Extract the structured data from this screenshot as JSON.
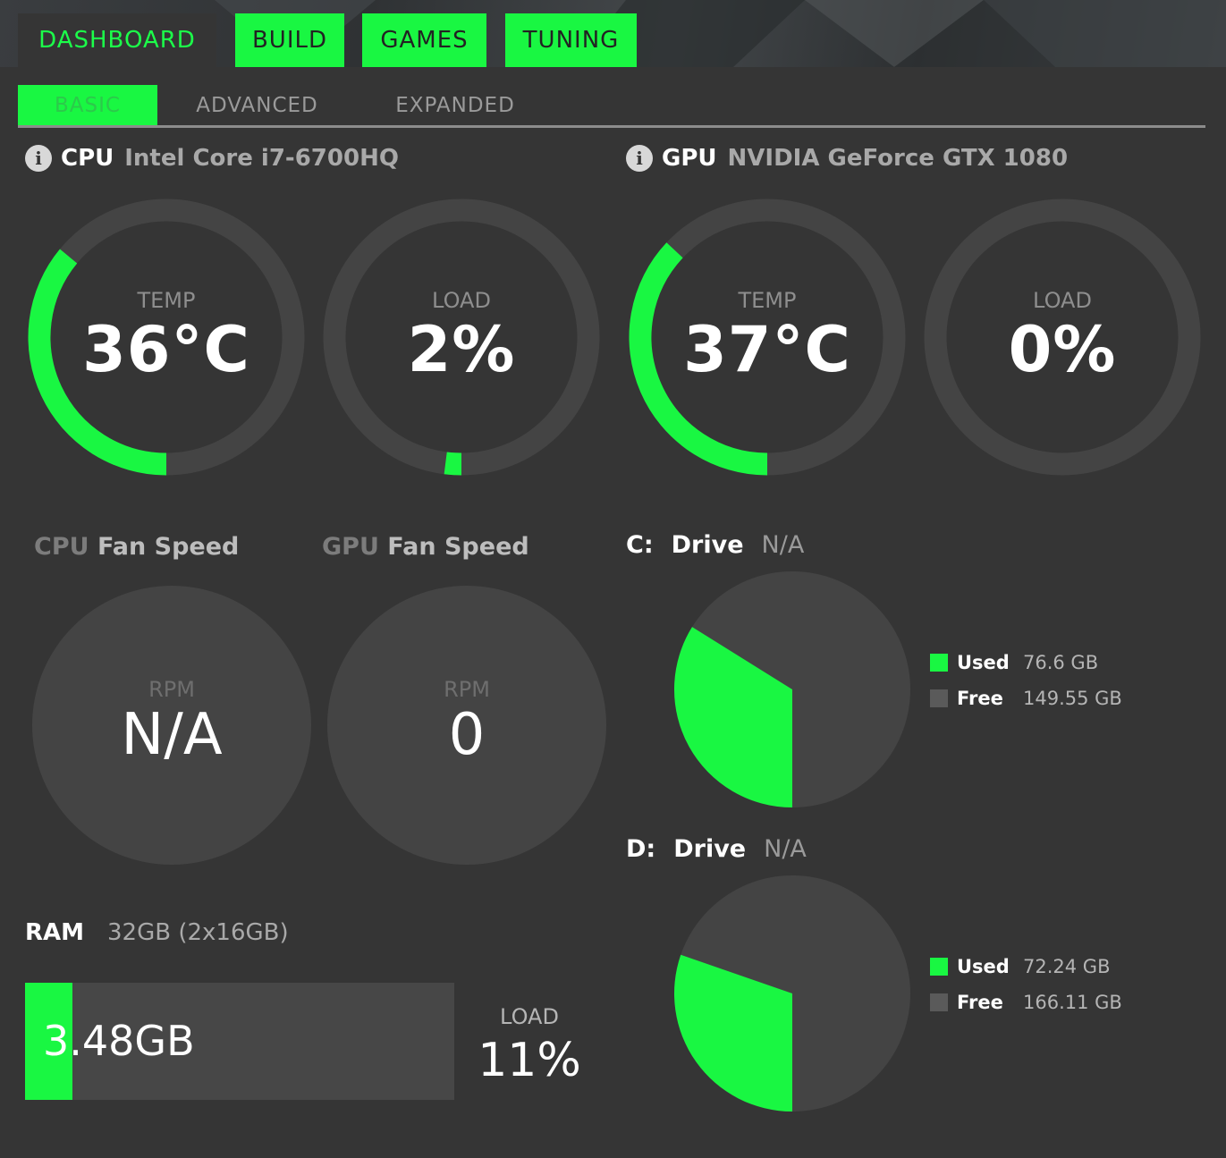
{
  "nav": {
    "main_tabs": [
      {
        "label": "DASHBOARD"
      },
      {
        "label": "BUILD"
      },
      {
        "label": "GAMES"
      },
      {
        "label": "TUNING"
      }
    ],
    "sub_tabs": [
      {
        "label": "BASIC"
      },
      {
        "label": "ADVANCED"
      },
      {
        "label": "EXPANDED"
      }
    ]
  },
  "cpu": {
    "heading": "CPU",
    "model": "Intel Core i7-6700HQ",
    "temp": {
      "label": "TEMP",
      "value": "36°C",
      "fraction": 0.36
    },
    "load": {
      "label": "LOAD",
      "value": "2%",
      "fraction": 0.02
    }
  },
  "gpu": {
    "heading": "GPU",
    "model": "NVIDIA GeForce GTX 1080",
    "temp": {
      "label": "TEMP",
      "value": "37°C",
      "fraction": 0.37
    },
    "load": {
      "label": "LOAD",
      "value": "0%",
      "fraction": 0.0
    }
  },
  "fans": {
    "cpu": {
      "prefix": "CPU",
      "title": "Fan Speed",
      "label": "RPM",
      "value": "N/A"
    },
    "gpu": {
      "prefix": "GPU",
      "title": "Fan Speed",
      "label": "RPM",
      "value": "0"
    }
  },
  "drives": [
    {
      "letter": "C:",
      "title": "Drive",
      "status": "N/A",
      "used_label": "Used",
      "used": "76.6 GB",
      "used_gb": 76.6,
      "free_label": "Free",
      "free": "149.55 GB",
      "free_gb": 149.55
    },
    {
      "letter": "D:",
      "title": "Drive",
      "status": "N/A",
      "used_label": "Used",
      "used": "72.24 GB",
      "used_gb": 72.24,
      "free_label": "Free",
      "free": "166.11 GB",
      "free_gb": 166.11
    }
  ],
  "ram": {
    "heading": "RAM",
    "spec": "32GB (2x16GB)",
    "used": "3.48GB",
    "load_label": "LOAD",
    "load_value": "11%",
    "fraction": 0.11
  },
  "colors": {
    "accent": "#19f742",
    "background": "#353535",
    "track": "#444444",
    "free": "#5a5a5a"
  }
}
